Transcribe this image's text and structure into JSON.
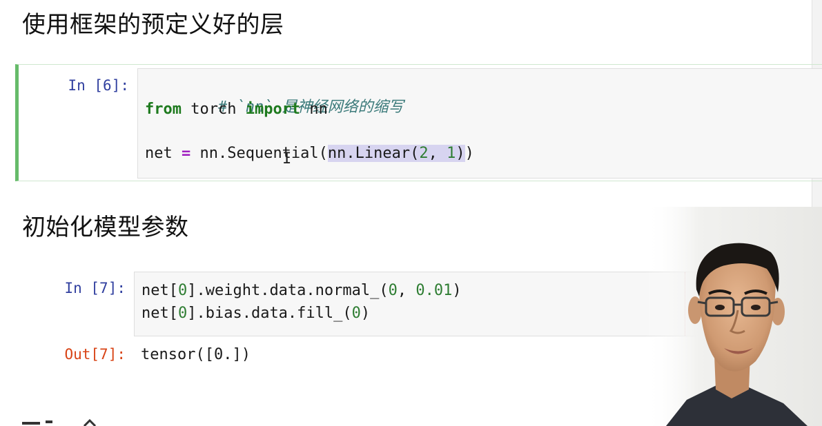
{
  "headings": {
    "layers": "使用框架的预定义好的层",
    "init": "初始化模型参数"
  },
  "cells": {
    "cell6": {
      "prompt": "In [6]:",
      "comment": "# `nn` 是神经网络的缩写",
      "line2": {
        "kw1": "from",
        "mid": " torch ",
        "kw2": "import",
        "tail": " nn"
      },
      "line4": {
        "pre": "net ",
        "op": "=",
        "mid": " nn.Sequential(",
        "sel_a": "nn.Linear(",
        "sel_num1": "2",
        "sel_b": ", ",
        "sel_num2": "1",
        "sel_c": ")",
        "post": ")"
      }
    },
    "cell7": {
      "prompt": "In [7]:",
      "line1": {
        "a": "net[",
        "n0": "0",
        "b": "].weight.data.normal_(",
        "n1": "0",
        "c": ", ",
        "n2": "0.01",
        "d": ")"
      },
      "line2": {
        "a": "net[",
        "n0": "0",
        "b": "].bias.data.fill_(",
        "n1": "0",
        "c": ")"
      },
      "out_prompt": "Out[7]:",
      "output": "tensor([0.])"
    }
  },
  "icons": {
    "cursor": "text-cursor-icon",
    "presenter": "webcam-presenter"
  },
  "colors": {
    "selected_cell_border": "#66bb6a",
    "in_prompt": "#303f9f",
    "out_prompt": "#d84315",
    "keyword": "#1e7a1e",
    "operator": "#a020c0",
    "comment": "#3b7a7a"
  }
}
